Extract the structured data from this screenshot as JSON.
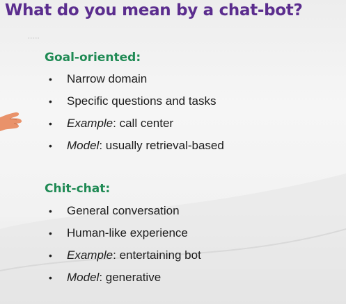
{
  "slide": {
    "title": "What do you mean by a chat-bot?",
    "sections": [
      {
        "heading": "Goal-oriented:",
        "items": [
          {
            "plain": "Narrow domain"
          },
          {
            "plain": "Specific questions and tasks"
          },
          {
            "label": "Example",
            "rest": ": call center"
          },
          {
            "label": "Model",
            "rest": ": usually retrieval-based"
          }
        ]
      },
      {
        "heading": "Chit-chat:",
        "items": [
          {
            "plain": "General conversation"
          },
          {
            "plain": "Human-like experience"
          },
          {
            "label": "Example",
            "rest": ": entertaining bot"
          },
          {
            "label": "Model",
            "rest": ": generative"
          }
        ]
      }
    ],
    "bullet_glyph": "•",
    "colors": {
      "title": "#5b2d8e",
      "heading": "#1f8a54",
      "text": "#1c1c1c",
      "hand": "#e9926a"
    }
  }
}
